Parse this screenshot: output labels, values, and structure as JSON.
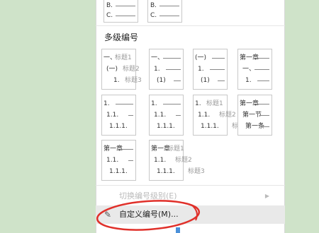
{
  "top_partial_tiles": [
    {
      "lines": [
        "B.",
        "C."
      ]
    },
    {
      "lines": [
        "B.",
        "C."
      ]
    }
  ],
  "section_title": "多级编号",
  "tiles": [
    {
      "lines": [
        {
          "label": "一、",
          "heading": "标题1"
        },
        {
          "label": "(一)",
          "heading": "标题2"
        },
        {
          "label": "1.",
          "heading": "标题3"
        }
      ]
    },
    {
      "lines": [
        {
          "label": "一、",
          "heading": ""
        },
        {
          "label": "1.",
          "heading": ""
        },
        {
          "label": "(1)",
          "heading": ""
        }
      ]
    },
    {
      "lines": [
        {
          "label": "(一)",
          "heading": ""
        },
        {
          "label": "1.",
          "heading": ""
        },
        {
          "label": "(1)",
          "heading": ""
        }
      ]
    },
    {
      "lines": [
        {
          "label": "第一章",
          "heading": ""
        },
        {
          "label": "一、",
          "heading": ""
        },
        {
          "label": "1.",
          "heading": ""
        }
      ]
    },
    {
      "lines": [
        {
          "label": "1.",
          "heading": ""
        },
        {
          "label": "1.1.",
          "heading": ""
        },
        {
          "label": "1.1.1.",
          "heading": ""
        }
      ]
    },
    {
      "lines": [
        {
          "label": "1.",
          "heading": ""
        },
        {
          "label": "1.1.",
          "heading": ""
        },
        {
          "label": "1.1.1.",
          "heading": ""
        }
      ]
    },
    {
      "lines": [
        {
          "label": "1.",
          "heading": "标题1"
        },
        {
          "label": "1.1.",
          "heading": "标题2"
        },
        {
          "label": "1.1.1.",
          "heading": "标题3"
        }
      ]
    },
    {
      "lines": [
        {
          "label": "第一章",
          "heading": ""
        },
        {
          "label": "第一节",
          "heading": ""
        },
        {
          "label": "第一条",
          "heading": ""
        }
      ]
    },
    {
      "lines": [
        {
          "label": "第一章",
          "heading": ""
        },
        {
          "label": "1.1.",
          "heading": ""
        },
        {
          "label": "1.1.1.",
          "heading": ""
        }
      ]
    },
    {
      "lines": [
        {
          "label": "第一章",
          "heading": "标题1"
        },
        {
          "label": "1.1.",
          "heading": "标题2"
        },
        {
          "label": "1.1.1.",
          "heading": "标题3"
        }
      ]
    }
  ],
  "menu": {
    "change_level_label": "切换编号级别(E)",
    "custom_label": "自定义编号(M)...",
    "pen_icon": "pencil-icon",
    "arrow_icon": "chevron-right-icon"
  },
  "colors": {
    "highlight_ellipse": "#e0302a",
    "background": "#cfe3cb",
    "panel": "#ffffff",
    "hover": "#e9e9e9"
  }
}
